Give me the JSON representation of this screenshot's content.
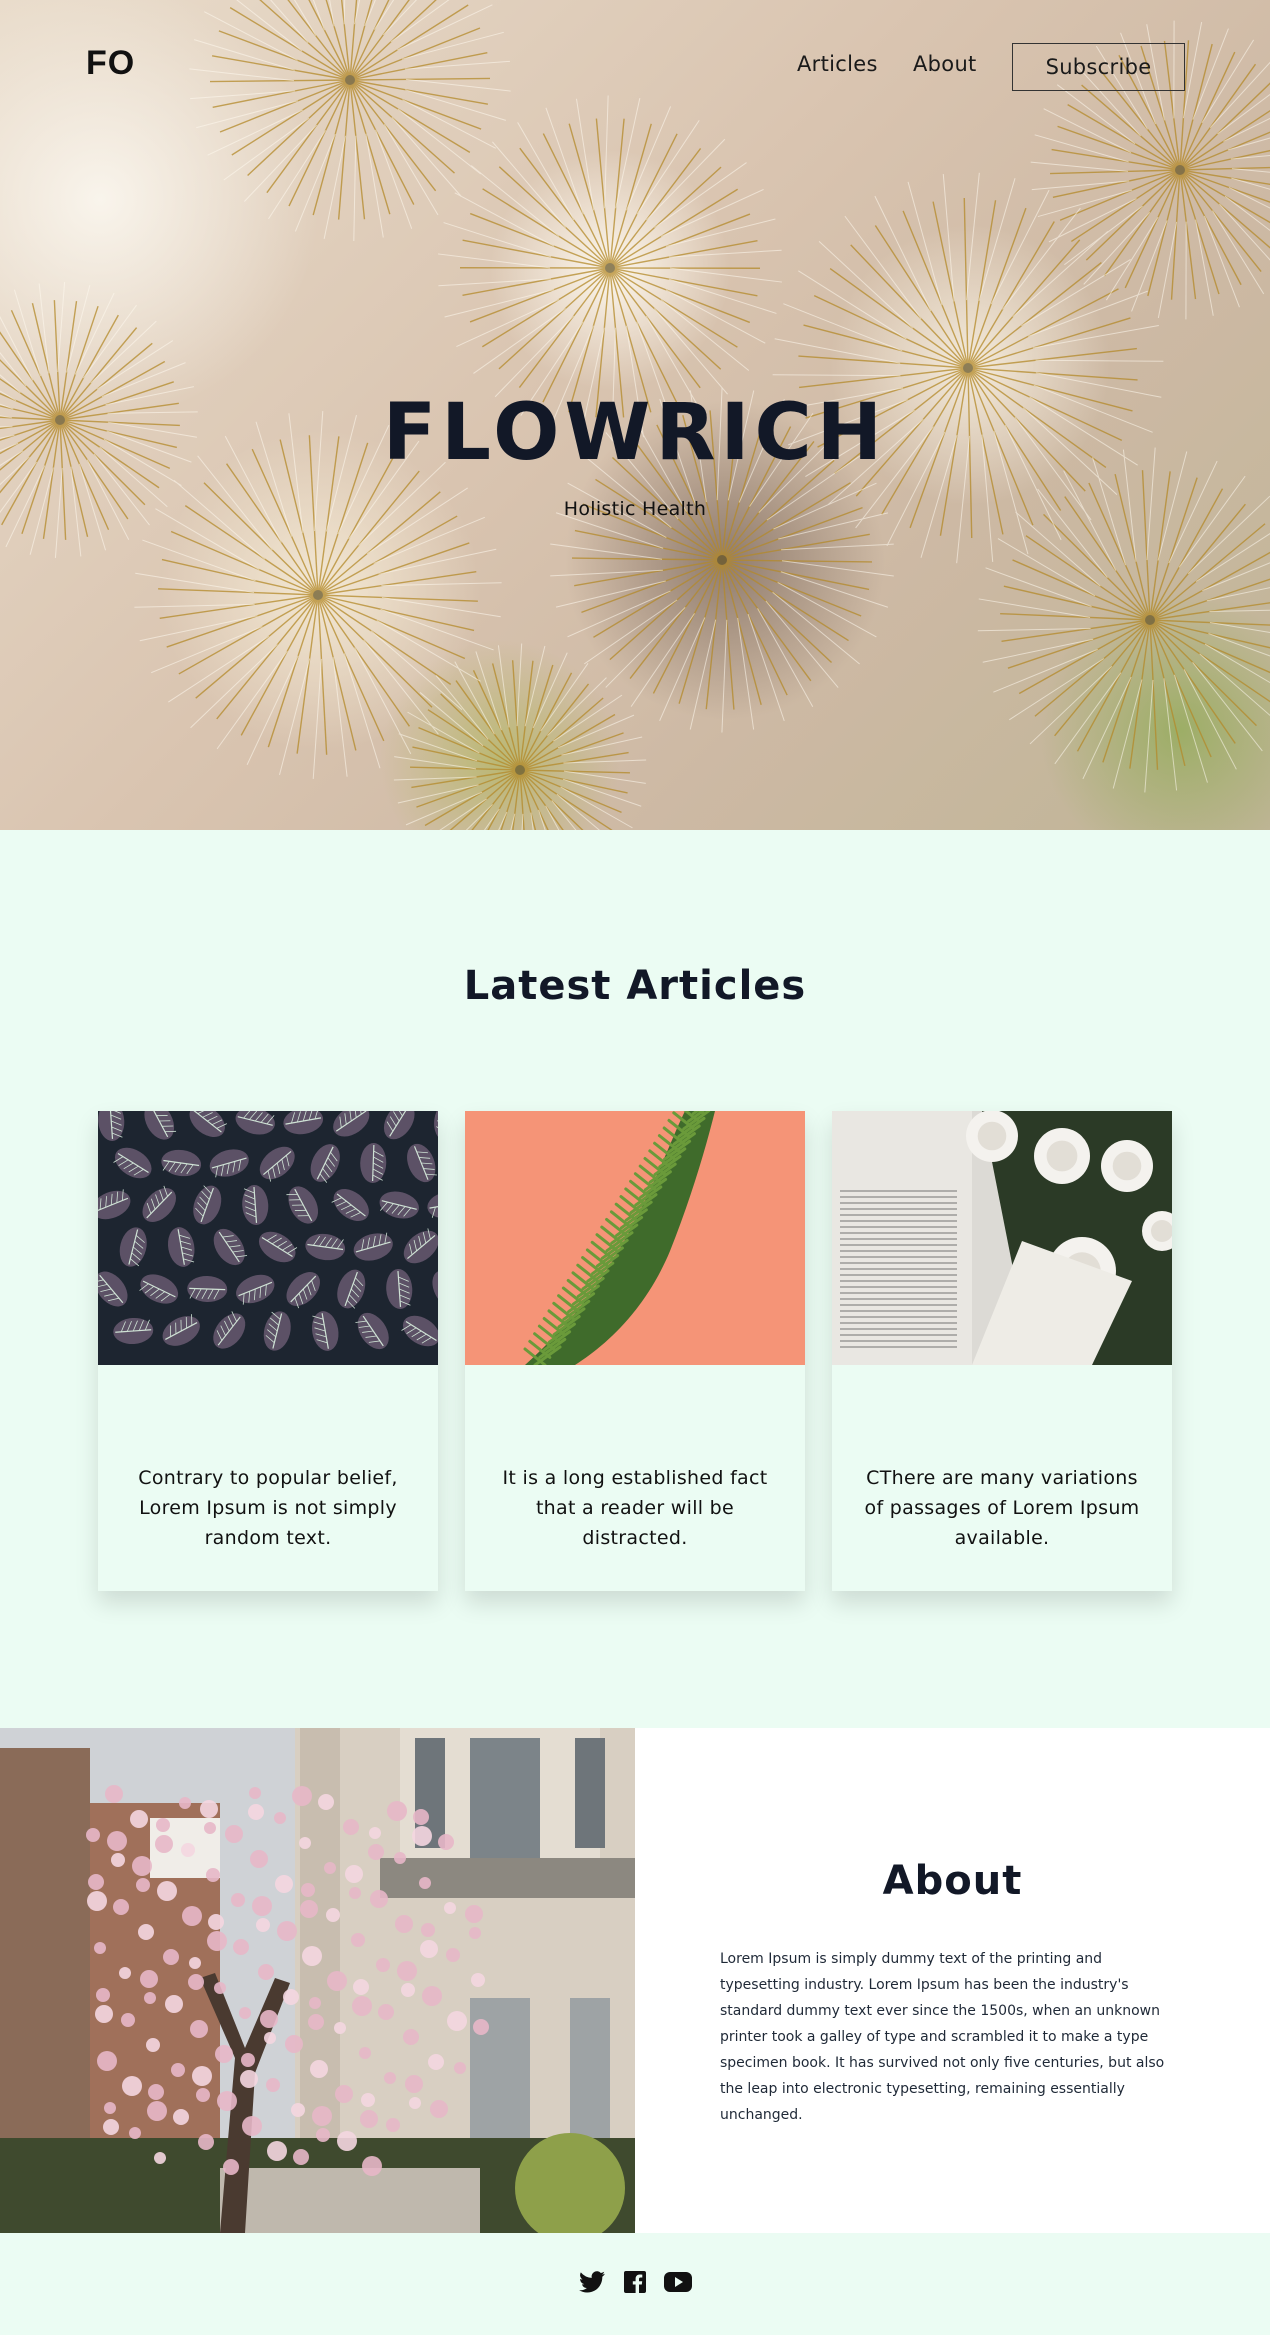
{
  "header": {
    "brand": "FO",
    "nav": [
      {
        "label": "Articles"
      },
      {
        "label": "About"
      }
    ],
    "subscribe_label": "Subscribe"
  },
  "hero": {
    "title": "FLOWRICH",
    "subtitle": "Holistic Health"
  },
  "articles": {
    "heading": "Latest Articles",
    "cards": [
      {
        "caption": "Contrary to popular belief, Lorem Ipsum is not simply random text.",
        "image": "dark-green-leaves"
      },
      {
        "caption": "It is a long established fact that a reader will be distracted.",
        "image": "green-plant-on-coral"
      },
      {
        "caption": "CThere are many variations of passages of Lorem Ipsum available.",
        "image": "white-roses-on-book"
      }
    ]
  },
  "about": {
    "heading": "About",
    "body": "Lorem Ipsum is simply dummy text of the printing and typesetting industry. Lorem Ipsum has been the industry's standard dummy text ever since the 1500s, when an unknown printer took a galley of type and scrambled it to make a type specimen book. It has survived not only five centuries, but also the leap into electronic typesetting, remaining essentially unchanged.",
    "image": "magnolia-tree-building"
  },
  "footer": {
    "social": [
      {
        "icon": "twitter-icon"
      },
      {
        "icon": "facebook-icon"
      },
      {
        "icon": "youtube-icon"
      }
    ]
  },
  "colors": {
    "mint_background": "#ebfcf3",
    "heading_navy": "#121827",
    "text": "#111111"
  }
}
